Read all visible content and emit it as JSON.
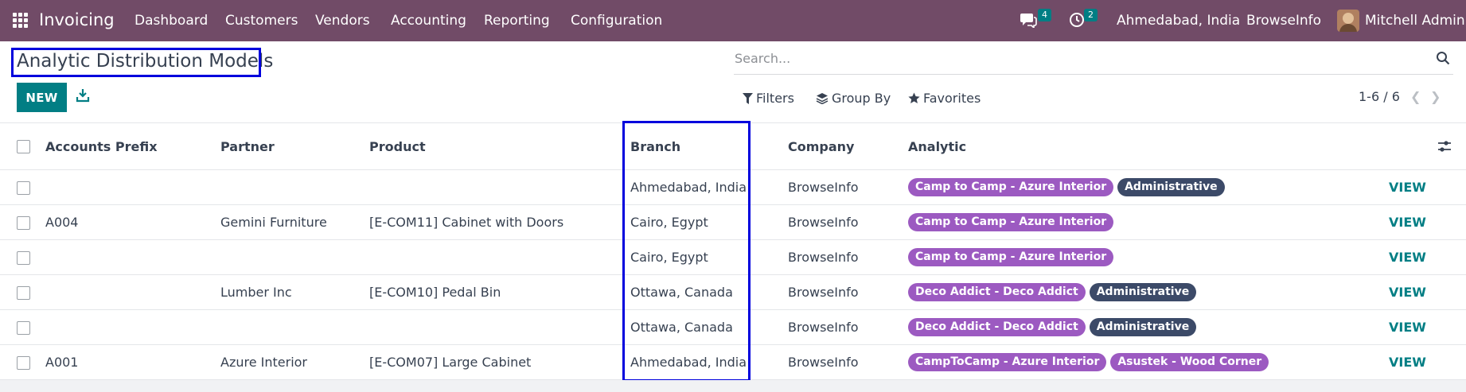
{
  "app": {
    "name": "Invoicing",
    "menu": [
      "Dashboard",
      "Customers",
      "Vendors",
      "Accounting",
      "Reporting",
      "Configuration"
    ],
    "messages_count": "4",
    "activities_count": "2",
    "branch": "Ahmedabad, India",
    "company": "BrowseInfo",
    "user": "Mitchell Admin"
  },
  "page": {
    "title": "Analytic Distribution Models",
    "new_label": "NEW",
    "search_placeholder": "Search...",
    "filters_label": "Filters",
    "groupby_label": "Group By",
    "favorites_label": "Favorites",
    "pager": "1-6 / 6"
  },
  "table": {
    "columns": [
      "Accounts Prefix",
      "Partner",
      "Product",
      "Branch",
      "Company",
      "Analytic"
    ],
    "view_label": "VIEW",
    "rows": [
      {
        "prefix": "",
        "partner": "",
        "product": "",
        "branch": "Ahmedabad, India",
        "company": "BrowseInfo",
        "tags": [
          {
            "text": "Camp to Camp - Azure Interior",
            "color": "purple"
          },
          {
            "text": "Administrative",
            "color": "navy"
          }
        ]
      },
      {
        "prefix": "A004",
        "partner": "Gemini Furniture",
        "product": "[E-COM11] Cabinet with Doors",
        "branch": "Cairo, Egypt",
        "company": "BrowseInfo",
        "tags": [
          {
            "text": "Camp to Camp - Azure Interior",
            "color": "purple"
          }
        ]
      },
      {
        "prefix": "",
        "partner": "",
        "product": "",
        "branch": "Cairo, Egypt",
        "company": "BrowseInfo",
        "tags": [
          {
            "text": "Camp to Camp - Azure Interior",
            "color": "purple"
          }
        ]
      },
      {
        "prefix": "",
        "partner": "Lumber Inc",
        "product": "[E-COM10] Pedal Bin",
        "branch": "Ottawa, Canada",
        "company": "BrowseInfo",
        "tags": [
          {
            "text": "Deco Addict - Deco Addict",
            "color": "purple"
          },
          {
            "text": "Administrative",
            "color": "navy"
          }
        ]
      },
      {
        "prefix": "",
        "partner": "",
        "product": "",
        "branch": "Ottawa, Canada",
        "company": "BrowseInfo",
        "tags": [
          {
            "text": "Deco Addict - Deco Addict",
            "color": "purple"
          },
          {
            "text": "Administrative",
            "color": "navy"
          }
        ]
      },
      {
        "prefix": "A001",
        "partner": "Azure Interior",
        "product": "[E-COM07] Large Cabinet",
        "branch": "Ahmedabad, India",
        "company": "BrowseInfo",
        "tags": [
          {
            "text": "CampToCamp - Azure Interior",
            "color": "purple"
          },
          {
            "text": "Asustek - Wood Corner",
            "color": "purple"
          }
        ]
      }
    ]
  },
  "colors": {
    "navbar": "#714B67",
    "primary": "#017E84",
    "highlight": "#0000dd",
    "tag_purple": "#9c5ac1",
    "tag_navy": "#3c4a68"
  }
}
